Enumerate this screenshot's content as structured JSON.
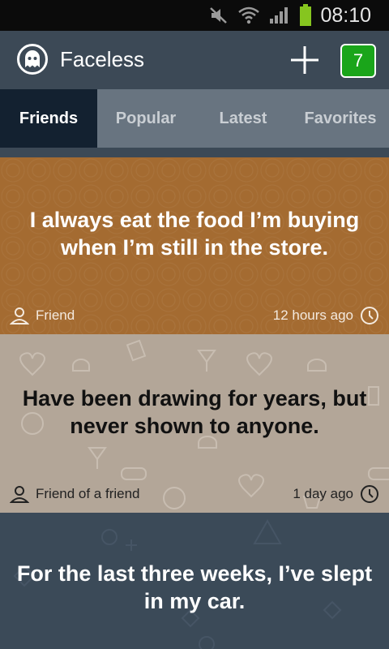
{
  "status_bar": {
    "time": "08:10",
    "icons": [
      "mute-icon",
      "wifi-icon",
      "signal-icon",
      "battery-icon"
    ]
  },
  "app_bar": {
    "title": "Faceless",
    "logo_icon": "ghost-icon",
    "add_icon": "plus-icon",
    "badge_count": "7",
    "badge_color": "#1aa51a"
  },
  "tabs": [
    {
      "label": "Friends",
      "active": true
    },
    {
      "label": "Popular",
      "active": false
    },
    {
      "label": "Latest",
      "active": false
    },
    {
      "label": "Favorites",
      "active": false
    }
  ],
  "posts": [
    {
      "text": "I always eat the food I’m buying when I’m still in the store.",
      "author": "Friend",
      "time": "12 hours ago",
      "background": "#a46b31"
    },
    {
      "text": "Have been drawing for years, but never shown to anyone.",
      "author": "Friend of a friend",
      "time": "1 day ago",
      "background": "#b3a698"
    },
    {
      "text": "For the last three weeks, I’ve slept in my car.",
      "background": "#3b4a58"
    }
  ]
}
